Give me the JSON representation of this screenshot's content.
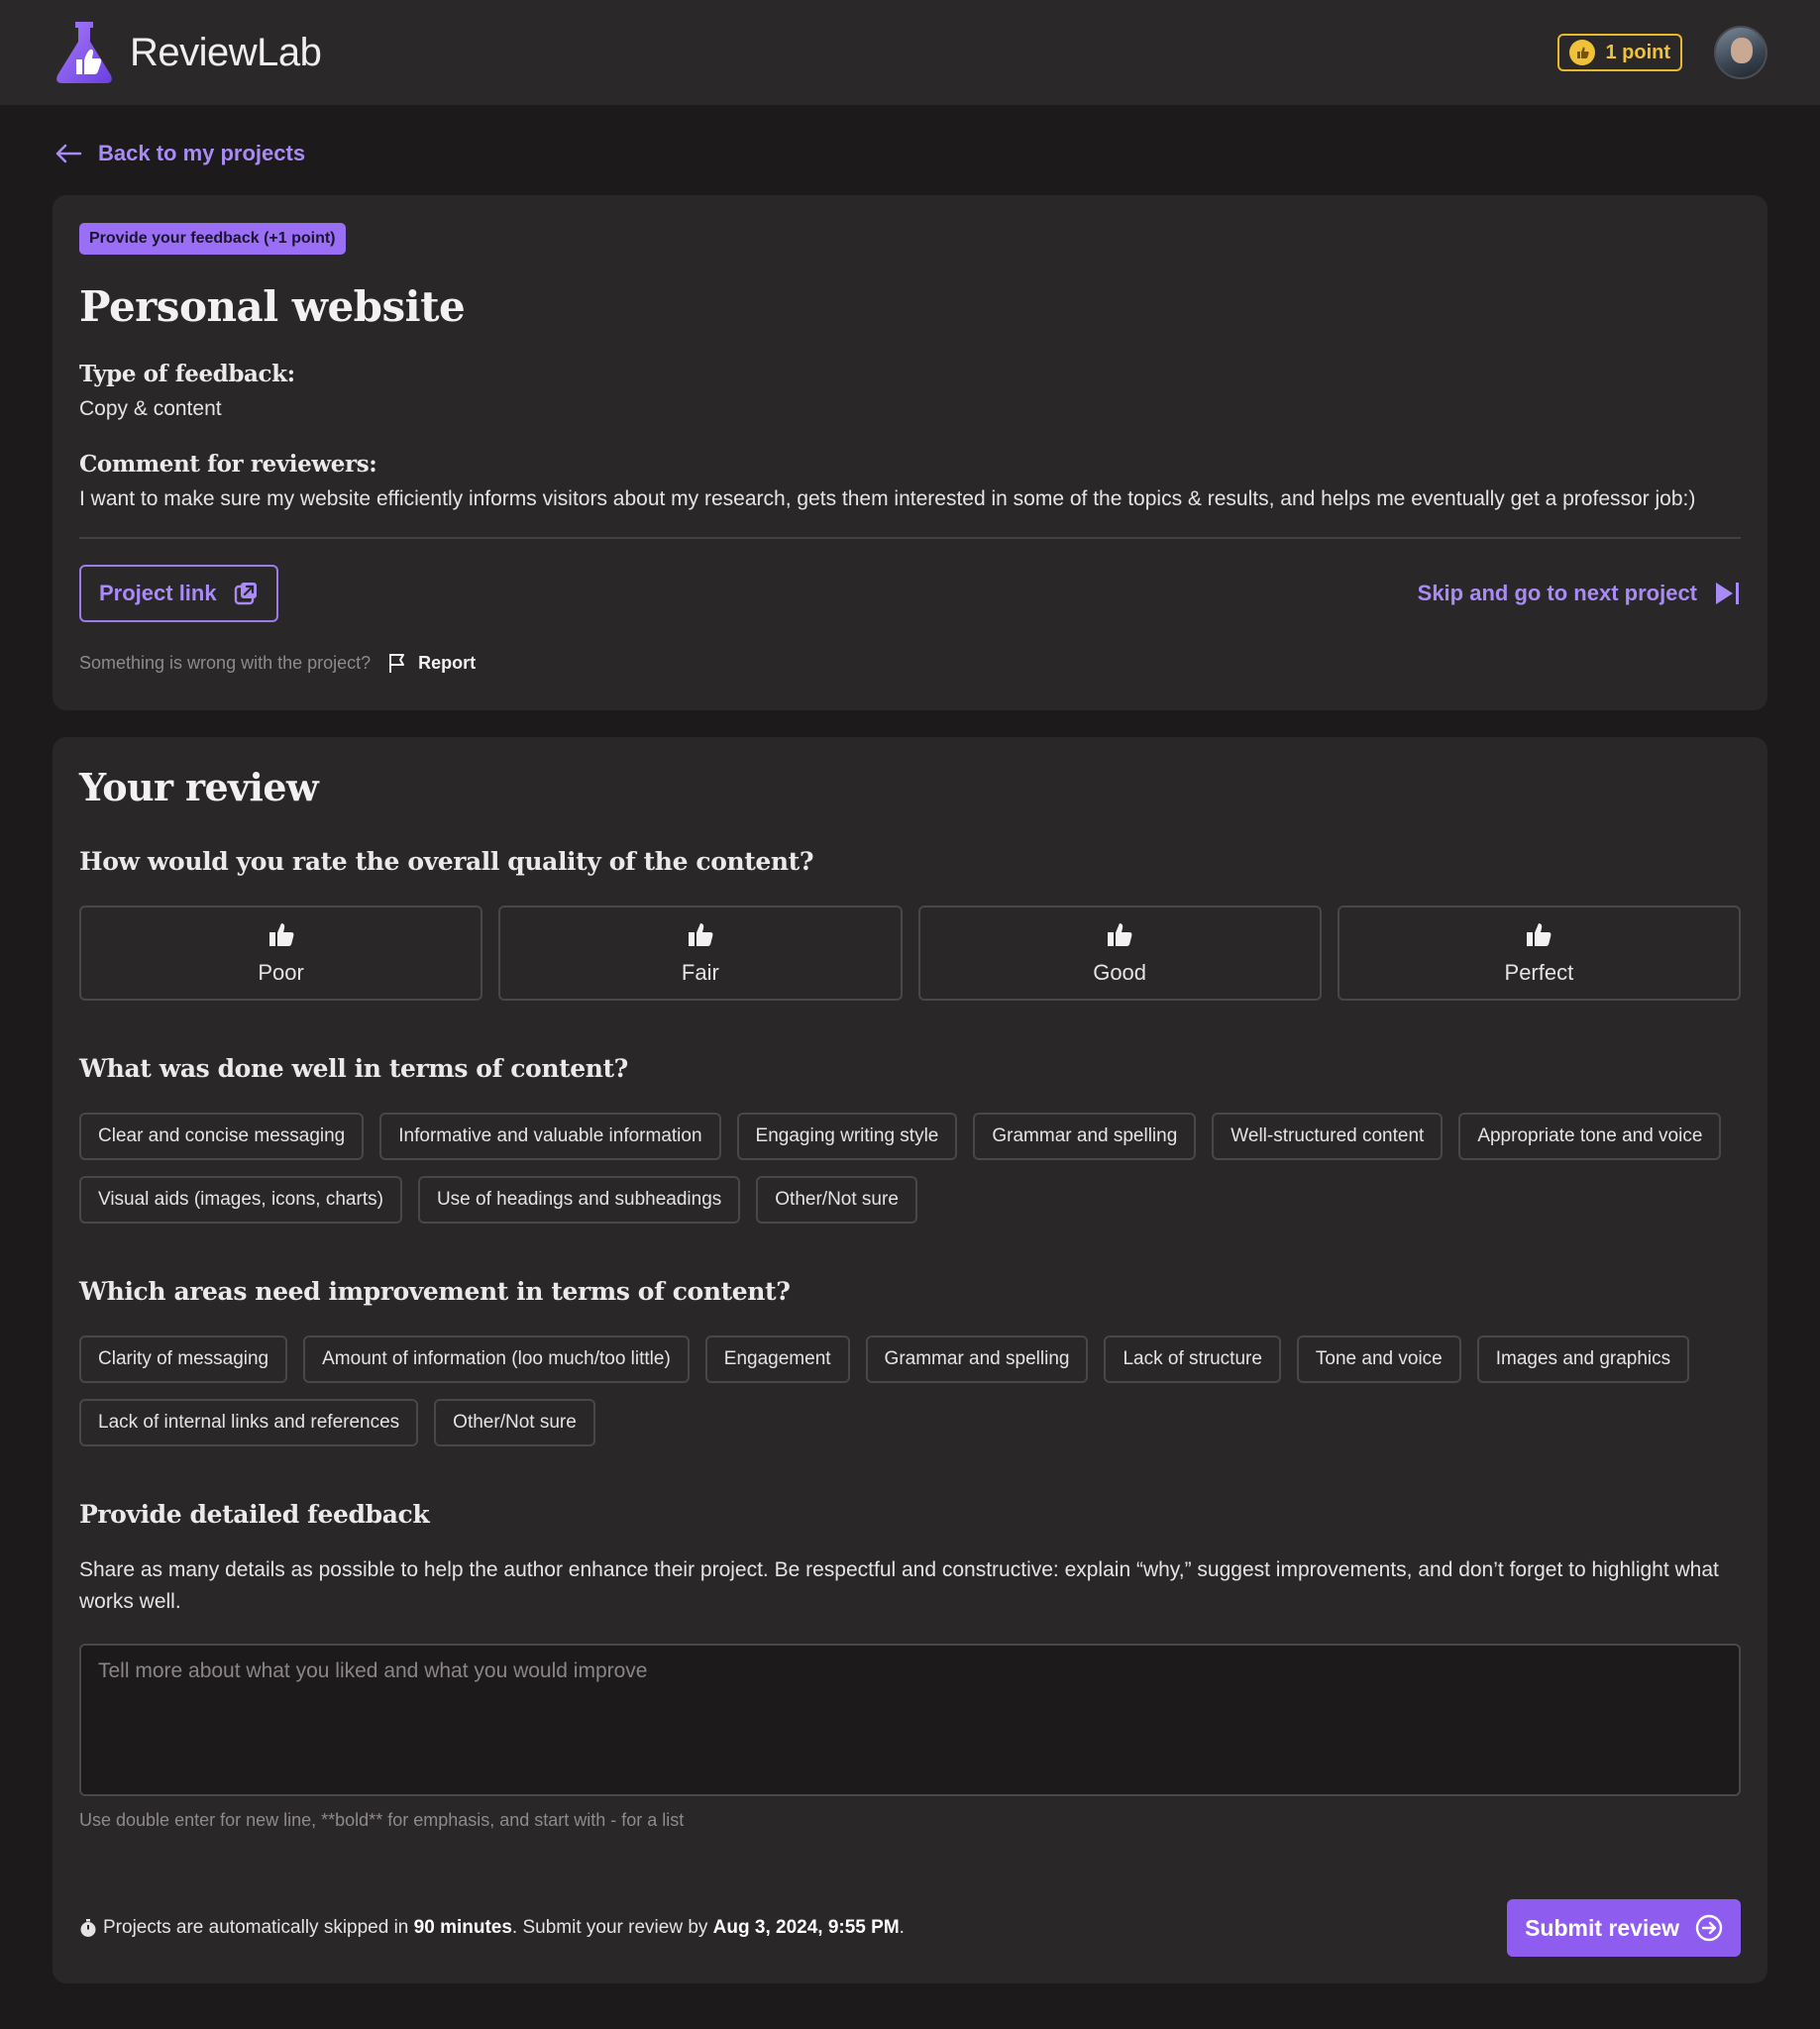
{
  "header": {
    "app_name": "ReviewLab",
    "points": "1 point",
    "logo_icon": "flask-thumbs-up-icon",
    "avatar_icon": "user-avatar"
  },
  "nav": {
    "back_label": "Back to my projects"
  },
  "project": {
    "tag": "Provide your feedback (+1 point)",
    "title": "Personal website",
    "feedback_type_label": "Type of feedback:",
    "feedback_type": "Copy & content",
    "comment_label": "Comment for reviewers:",
    "comment": "I want to make sure my website efficiently informs visitors about my research, gets them interested in some of the topics & results, and helps me eventually get a professor job:)",
    "project_link_label": "Project link",
    "skip_label": "Skip and go to next project",
    "report_prompt": "Something is wrong with the project?",
    "report_label": "Report"
  },
  "review": {
    "title": "Your review",
    "rating_question": "How would you rate the overall quality of the content?",
    "ratings": [
      "Poor",
      "Fair",
      "Good",
      "Perfect"
    ],
    "done_well_question": "What was done well in terms of content?",
    "done_well_options": [
      "Clear and concise messaging",
      "Informative and valuable information",
      "Engaging writing style",
      "Grammar and spelling",
      "Well-structured content",
      "Appropriate tone and voice",
      "Visual aids (images, icons, charts)",
      "Use of headings and subheadings",
      "Other/Not sure"
    ],
    "improve_question": "Which areas need improvement in terms of content?",
    "improve_options": [
      "Clarity of messaging",
      "Amount of information (loo much/too little)",
      "Engagement",
      "Grammar and spelling",
      "Lack of structure",
      "Tone and voice",
      "Images and graphics",
      "Lack of internal links and references",
      "Other/Not sure"
    ],
    "detail_title": "Provide detailed feedback",
    "detail_desc": "Share as many details as possible to help the author enhance their project. Be respectful and constructive: explain “why,” suggest improvements, and don’t forget to highlight what works well.",
    "textarea_placeholder": "Tell more about what you liked and what you would improve",
    "hint": "Use double enter for new line, **bold** for emphasis, and start with - for a list",
    "deadline_prefix": "Projects are automatically skipped in",
    "deadline_duration": "90 minutes",
    "deadline_mid": ". Submit your review by",
    "deadline_date": "Aug 3, 2024, 9:55 PM",
    "deadline_suffix": ".",
    "submit_label": "Submit review"
  },
  "colors": {
    "accent": "#9a6ff5",
    "gold": "#f0c23a",
    "background": "#1c1a1b",
    "card": "#2a2728"
  }
}
